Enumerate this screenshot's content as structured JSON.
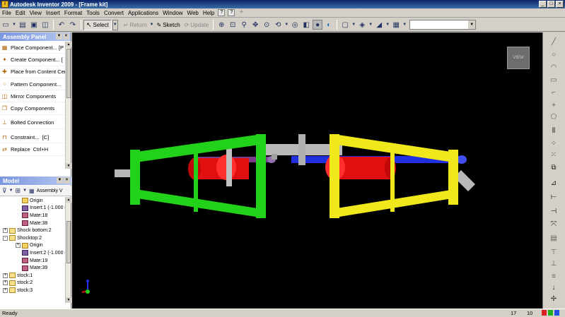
{
  "window": {
    "title": "Autodesk Inventor 2009 - [Frame kit]",
    "app_icon": "inventor-logo-icon"
  },
  "menubar": {
    "items": [
      "File",
      "Edit",
      "View",
      "Insert",
      "Format",
      "Tools",
      "Convert",
      "Applications",
      "Window",
      "Web",
      "Help"
    ]
  },
  "toolbar": {
    "select_label": "Select",
    "return_label": "Return",
    "sketch_label": "Sketch",
    "update_label": "Update",
    "combo_value": ""
  },
  "assembly_panel": {
    "title": "Assembly Panel",
    "commands": [
      {
        "label": "Place Component...",
        "shortcut": "[P",
        "icon": "place-component-icon"
      },
      {
        "label": "Create Component...",
        "shortcut": "[",
        "icon": "create-component-icon"
      },
      {
        "label": "Place from Content Cen",
        "shortcut": "",
        "icon": "content-center-icon"
      },
      {
        "label": "Pattern Component...",
        "shortcut": "",
        "icon": "pattern-component-icon"
      },
      {
        "label": "Mirror Components",
        "shortcut": "",
        "icon": "mirror-components-icon"
      },
      {
        "label": "Copy Components",
        "shortcut": "",
        "icon": "copy-components-icon"
      },
      {
        "label": "Bolted Connection",
        "shortcut": "",
        "icon": "bolted-connection-icon"
      },
      {
        "label": "Constraint...",
        "shortcut": "[C]",
        "icon": "constraint-icon"
      },
      {
        "label": "Replace",
        "shortcut": "Ctrl+H",
        "icon": "replace-icon"
      }
    ]
  },
  "model_browser": {
    "title": "Model",
    "view_label": "Assembly V",
    "tree": [
      {
        "label": "Origin",
        "indent": 2,
        "icon": "folder",
        "expander": ""
      },
      {
        "label": "Insert:1 (-1.000 in",
        "indent": 2,
        "icon": "constraint",
        "expander": ""
      },
      {
        "label": "Mate:18",
        "indent": 2,
        "icon": "mate",
        "expander": ""
      },
      {
        "label": "Mate:38",
        "indent": 2,
        "icon": "mate",
        "expander": ""
      },
      {
        "label": "Shock bottom:2",
        "indent": 0,
        "icon": "part",
        "expander": "+"
      },
      {
        "label": "Shocktop:2",
        "indent": 0,
        "icon": "part",
        "expander": "-"
      },
      {
        "label": "Origin",
        "indent": 2,
        "icon": "folder",
        "expander": "+"
      },
      {
        "label": "Insert:2 (-1.000 in",
        "indent": 2,
        "icon": "constraint",
        "expander": ""
      },
      {
        "label": "Mate:19",
        "indent": 2,
        "icon": "mate",
        "expander": ""
      },
      {
        "label": "Mate:39",
        "indent": 2,
        "icon": "mate",
        "expander": ""
      },
      {
        "label": "stock:1",
        "indent": 0,
        "icon": "part",
        "expander": "+"
      },
      {
        "label": "stock:2",
        "indent": 0,
        "icon": "part",
        "expander": "+"
      },
      {
        "label": "stock:3",
        "indent": 0,
        "icon": "part",
        "expander": "+"
      }
    ]
  },
  "viewcube": {
    "label": "VIEW"
  },
  "statusbar": {
    "message": "Ready",
    "count1": "17",
    "count2": "10"
  },
  "colors": {
    "frame_green": "#22d21a",
    "frame_yellow": "#f0e81a",
    "shock_red": "#e01010",
    "rod_blue": "#2030e0",
    "rod_purple": "#7a3a8a",
    "steel_gray": "#b8b8b8"
  }
}
